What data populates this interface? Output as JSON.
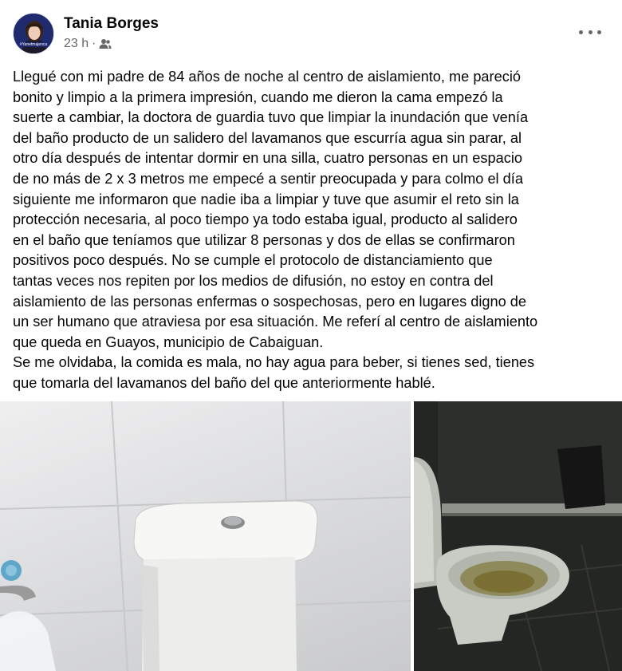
{
  "post": {
    "author": "Tania Borges",
    "time": "23 h",
    "separator": "·",
    "avatar_caption": "#Yanetmajenca",
    "audience_icon": "friends-icon",
    "more_icon": "more-options-icon",
    "text": "Llegué con mi padre de 84 años de noche al centro de aislamiento, me pareció\nbonito y limpio a la primera impresión, cuando me dieron la cama empezó la\nsuerte a cambiar, la doctora de guardia tuvo que limpiar la inundación que venía\ndel baño producto de un salidero del lavamanos que escurría agua sin parar, al\notro día después de intentar dormir en una silla, cuatro personas en un espacio\nde no más de 2 x 3 metros me empecé a sentir preocupada y para colmo el día\nsiguiente me informaron que nadie iba a limpiar y tuve que asumir el reto sin la\nprotección necesaria, al poco tiempo ya todo estaba igual, producto al salidero\nen el baño que teníamos que utilizar 8 personas y dos de ellas se confirmaron\npositivos poco después. No se cumple el protocolo de distanciamiento que\ntantas veces nos repiten por los medios de difusión, no estoy en contra del\naislamiento de las personas enfermas o sospechosas, pero en lugares digno de\nun ser humano que atraviesa por esa situación. Me referí al centro de aislamiento\nque queda en Guayos, municipio de Cabaiguan.\nSe me olvidaba, la comida es mala, no hay agua para beber, si tienes sed, tienes\nque tomarla del lavamanos del baño del que anteriormente hablé."
  },
  "photos": {
    "left": "toilet-tank-photo",
    "right": "toilet-bowl-photo"
  }
}
